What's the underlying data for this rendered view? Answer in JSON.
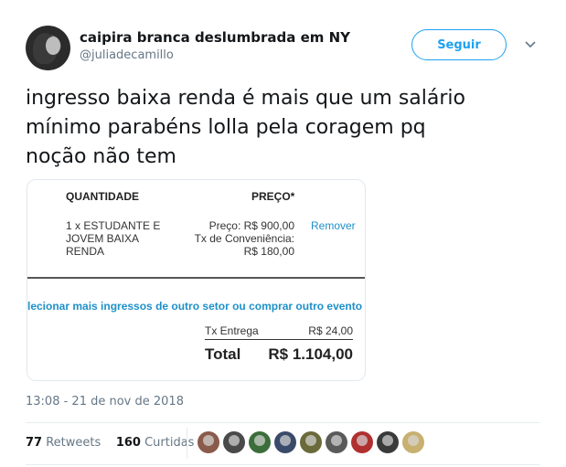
{
  "author": {
    "name": "caipira branca deslumbrada em NY",
    "handle": "@juliadecamillo"
  },
  "follow_label": "Seguir",
  "tweet": {
    "line1": "ingresso baixa renda é mais que um salário",
    "line2": "mínimo parabéns lolla pela coragem pq",
    "line3": "noção não tem"
  },
  "ticket": {
    "quantity_header": "QUANTIDADE",
    "price_header": "PREÇO*",
    "item_line1": "1 x ESTUDANTE E",
    "item_line2": "JOVEM BAIXA",
    "item_line3": "RENDA",
    "price_line1": "Preço: R$ 900,00",
    "price_line2": "Tx de Conveniência:",
    "price_line3": "R$ 180,00",
    "remove_label": "Remover",
    "more_link": "lecionar mais ingressos de outro setor ou comprar outro evento",
    "delivery_label": "Tx Entrega",
    "delivery_value": "R$ 24,00",
    "total_label": "Total",
    "total_value": "R$ 1.104,00"
  },
  "timestamp": "13:08 - 21 de nov de 2018",
  "stats": {
    "retweets_count": "77",
    "retweets_label": "Retweets",
    "likes_count": "160",
    "likes_label": "Curtidas"
  },
  "likers": [
    {
      "color": "#8a5a4a"
    },
    {
      "color": "#4a4a4a"
    },
    {
      "color": "#3c6e3c"
    },
    {
      "color": "#3a4a6a"
    },
    {
      "color": "#6a6a3a"
    },
    {
      "color": "#5a5a5a"
    },
    {
      "color": "#b03030"
    },
    {
      "color": "#3a3a3a"
    },
    {
      "color": "#c8b070"
    }
  ],
  "colors": {
    "accent": "#1da1f2",
    "link": "#1e90c8",
    "muted": "#657786"
  }
}
